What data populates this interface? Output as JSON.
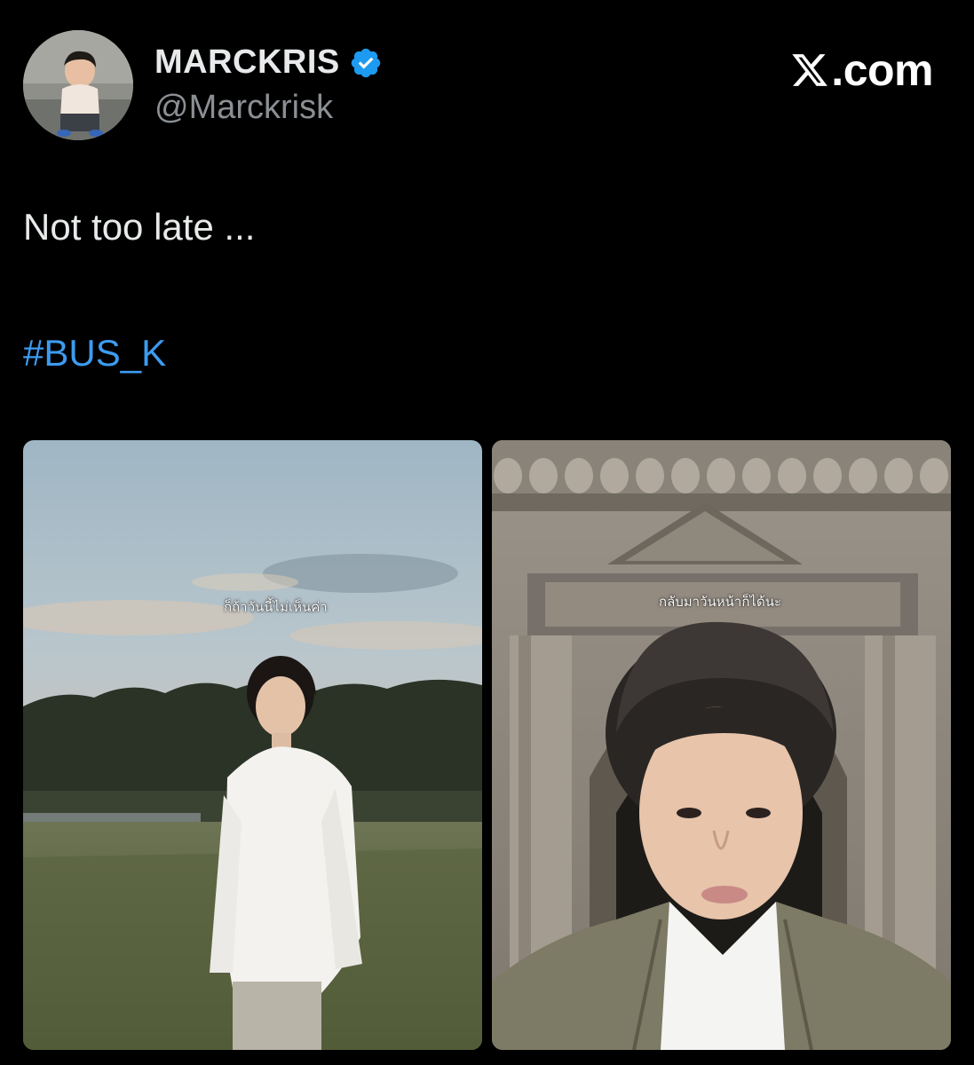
{
  "brand": {
    "label": ".com",
    "logo_icon": "x-logo-icon"
  },
  "author": {
    "display_name": "MARCKRIS",
    "handle": "@Marckrisk",
    "verified": true,
    "verified_color": "#1d9bf0"
  },
  "tweet": {
    "text": "Not too late ...",
    "hashtag": "#BUS_K",
    "hashtag_color": "#3d9bf0"
  },
  "media": [
    {
      "caption": "ก็ถ้าวันนี้ไม่เห็นค่า"
    },
    {
      "caption": "กลับมาวันหน้าก็ได้นะ"
    }
  ]
}
